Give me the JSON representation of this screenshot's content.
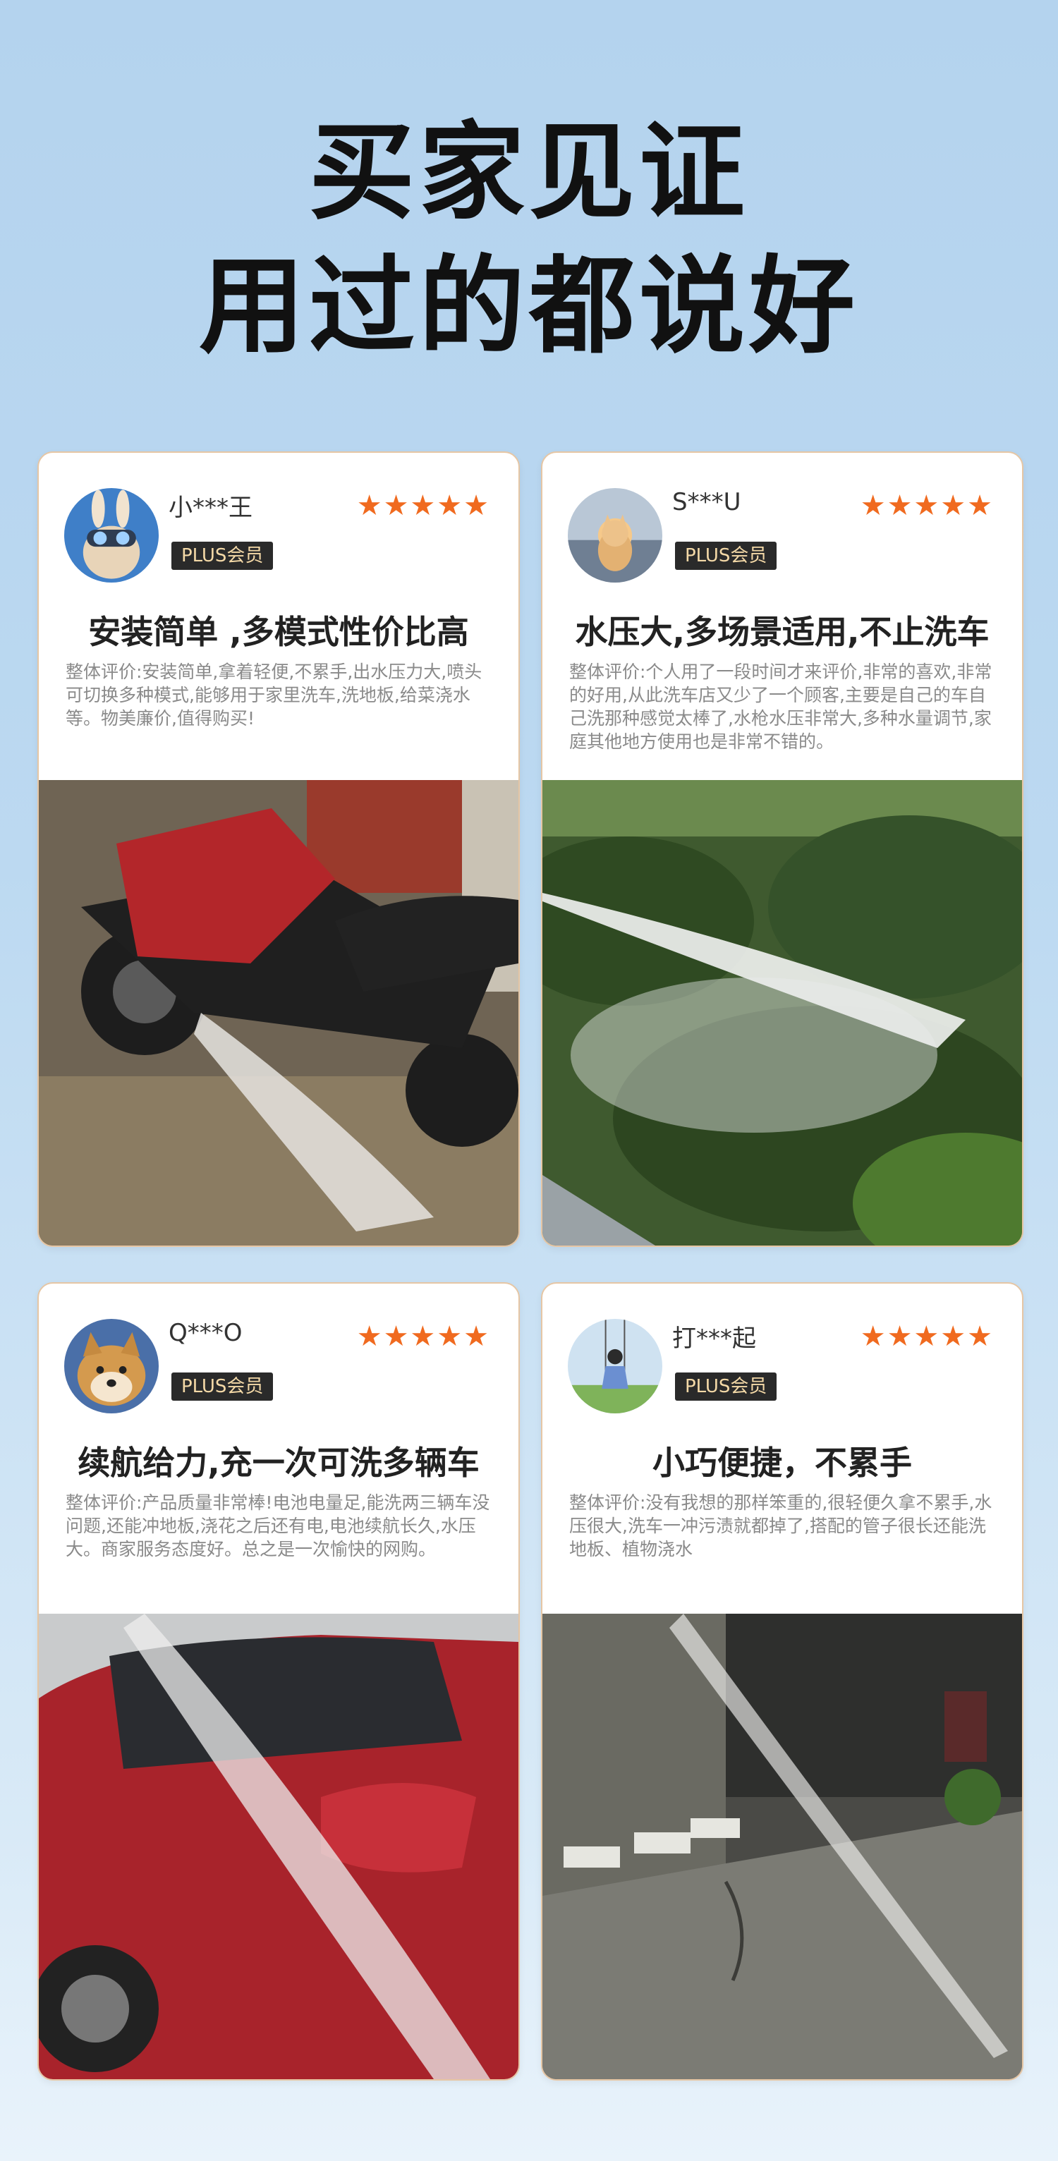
{
  "headline": {
    "line1": "买家见证",
    "line2": "用过的都说好"
  },
  "reviews": [
    {
      "username": "小***王",
      "badge": "PLUS会员",
      "stars": "★★★★★",
      "title": "安装简单 ,多模式性价比高",
      "text": "整体评价:安装简单,拿着轻便,不累手,出水压力大,喷头可切换多种模式,能够用于家里洗车,洗地板,给菜浇水等。物美廉价,值得购买!",
      "avatar_icon": "rabbit-goggles-avatar-icon",
      "photo": "motorcycle-washing-photo"
    },
    {
      "username": "S***U",
      "badge": "PLUS会员",
      "stars": "★★★★★",
      "title": "水压大,多场景适用,不止洗车",
      "text": "整体评价:个人用了一段时间才来评价,非常的喜欢,非常的好用,从此洗车店又少了一个顾客,主要是自己的车自己洗那种感觉太棒了,水枪水压非常大,多种水量调节,家庭其他地方使用也是非常不错的。",
      "avatar_icon": "cat-sunset-avatar-icon",
      "photo": "garden-spray-photo"
    },
    {
      "username": "Q***O",
      "badge": "PLUS会员",
      "stars": "★★★★★",
      "title": "续航给力,充一次可洗多辆车",
      "text": "整体评价:产品质量非常棒!电池电量足,能洗两三辆车没问题,还能冲地板,浇花之后还有电,电池续航长久,水压大。商家服务态度好。总之是一次愉快的网购。",
      "avatar_icon": "shiba-dog-avatar-icon",
      "photo": "red-car-washing-photo"
    },
    {
      "username": "打***起",
      "badge": "PLUS会员",
      "stars": "★★★★★",
      "title": "小巧便捷，不累手",
      "text": "整体评价:没有我想的那样笨重的,很轻便久拿不累手,水压很大,洗车一冲污渍就都掉了,搭配的管子很长还能洗地板、植物浇水",
      "avatar_icon": "girl-swing-avatar-icon",
      "photo": "courtyard-spray-photo"
    }
  ],
  "colors": {
    "background": "#b4d3ee",
    "stars": "#f06a1f",
    "badge_bg": "#2a2a2a",
    "badge_text": "#f4d9a7",
    "card_border": "#e6c6a4"
  }
}
